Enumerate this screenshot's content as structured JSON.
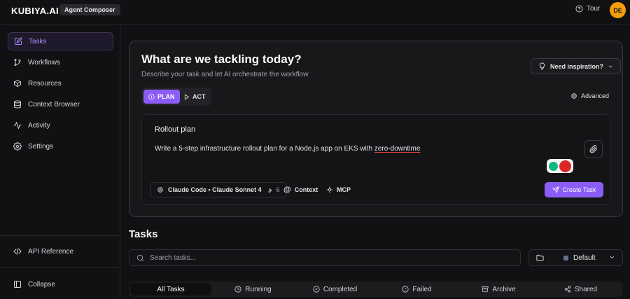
{
  "app": {
    "logo": "KUBIYA.AI",
    "badge": "Agent Composer",
    "tour_label": "Tour",
    "avatar_initials": "DE",
    "accent_color": "#8b5cf6"
  },
  "sidebar": {
    "items": [
      {
        "label": "Tasks",
        "icon": "checkbox-edit-icon",
        "active": true
      },
      {
        "label": "Workflows",
        "icon": "git-branch-icon"
      },
      {
        "label": "Resources",
        "icon": "cube-icon"
      },
      {
        "label": "Context Browser",
        "icon": "database-icon"
      },
      {
        "label": "Activity",
        "icon": "activity-icon"
      },
      {
        "label": "Settings",
        "icon": "gear-icon"
      }
    ],
    "api_reference": "API Reference",
    "collapse": "Collapse"
  },
  "hero": {
    "title": "What are we tackling today?",
    "subtitle": "Describe your task and let AI orchestrate the workflow",
    "inspiration_label": "Need inspiration?",
    "modes": {
      "plan": "PLAN",
      "act": "ACT",
      "selected": "PLAN"
    },
    "advanced_label": "Advanced",
    "task": {
      "title": "Rollout plan",
      "body_prefix": "Write a 5-step infrastructure rollout plan for a Node.js app on EKS with ",
      "body_underlined": "zero-downtime"
    },
    "model": {
      "label": "Claude Code • Claude Sonnet 4",
      "tools_count": "6"
    },
    "context_label": "Context",
    "mcp_label": "MCP",
    "create_label": "Create Task"
  },
  "tasks": {
    "heading": "Tasks",
    "search_placeholder": "Search tasks...",
    "filter_value": "Default",
    "tabs": [
      {
        "label": "All Tasks",
        "active": true
      },
      {
        "label": "Running",
        "icon": "clock-icon"
      },
      {
        "label": "Completed",
        "icon": "check-circle-icon"
      },
      {
        "label": "Failed",
        "icon": "alert-circle-icon"
      },
      {
        "label": "Archive",
        "icon": "archive-icon"
      },
      {
        "label": "Shared",
        "icon": "share-icon"
      }
    ]
  }
}
